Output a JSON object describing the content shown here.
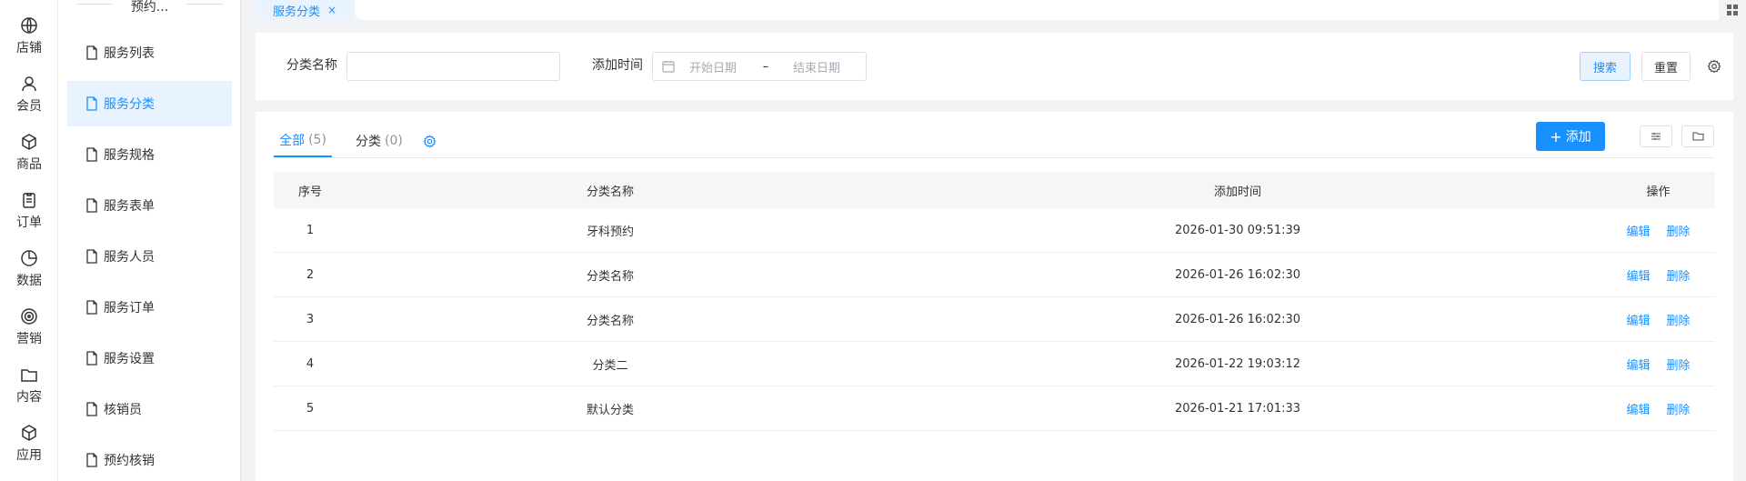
{
  "rail": [
    {
      "label": "店铺",
      "icon": "globe-icon"
    },
    {
      "label": "会员",
      "icon": "user-icon"
    },
    {
      "label": "商品",
      "icon": "box-icon"
    },
    {
      "label": "订单",
      "icon": "clipboard-icon"
    },
    {
      "label": "数据",
      "icon": "pie-chart-icon"
    },
    {
      "label": "营销",
      "icon": "target-icon"
    },
    {
      "label": "内容",
      "icon": "folder-icon"
    },
    {
      "label": "应用",
      "icon": "cube-icon"
    }
  ],
  "submenu": {
    "title": "预约...",
    "items": [
      {
        "label": "服务列表"
      },
      {
        "label": "服务分类",
        "active": true
      },
      {
        "label": "服务规格"
      },
      {
        "label": "服务表单"
      },
      {
        "label": "服务人员"
      },
      {
        "label": "服务订单"
      },
      {
        "label": "服务设置"
      },
      {
        "label": "核销员"
      },
      {
        "label": "预约核销"
      }
    ]
  },
  "tabbar": {
    "active_tab": "服务分类",
    "close_glyph": "×"
  },
  "search": {
    "name_label": "分类名称",
    "name_value": "",
    "time_label": "添加时间",
    "start_placeholder": "开始日期",
    "separator": "–",
    "end_placeholder": "结束日期",
    "search_button": "搜索",
    "reset_button": "重置"
  },
  "list": {
    "tabs": [
      {
        "label": "全部",
        "count": "(5)",
        "active": true
      },
      {
        "label": "分类",
        "count": "(0)",
        "active": false
      }
    ],
    "add_button": "添加",
    "add_icon": "+",
    "columns": [
      "序号",
      "分类名称",
      "添加时间",
      "操作"
    ],
    "rows": [
      {
        "idx": "1",
        "name": "牙科预约",
        "time": "2026-01-30 09:51:39",
        "edit": "编辑",
        "del": "删除"
      },
      {
        "idx": "2",
        "name": "分类名称",
        "time": "2026-01-26 16:02:30",
        "edit": "编辑",
        "del": "删除"
      },
      {
        "idx": "3",
        "name": "分类名称",
        "time": "2026-01-26 16:02:30",
        "edit": "编辑",
        "del": "删除"
      },
      {
        "idx": "4",
        "name": "分类二",
        "time": "2026-01-22 19:03:12",
        "edit": "编辑",
        "del": "删除"
      },
      {
        "idx": "5",
        "name": "默认分类",
        "time": "2026-01-21 17:01:33",
        "edit": "编辑",
        "del": "删除"
      }
    ]
  },
  "colors": {
    "accent": "#1890ff",
    "active_bg": "#e8f3ff",
    "page_bg": "#f2f3f5"
  }
}
